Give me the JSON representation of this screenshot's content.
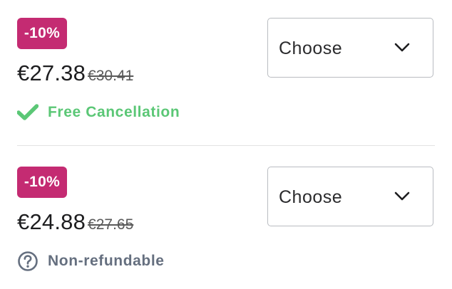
{
  "colors": {
    "badge_background": "#c42b72",
    "free_cancellation": "#5bc776",
    "non_refundable": "#656f7f"
  },
  "offers": [
    {
      "discount": "-10%",
      "price_current": "€27.38",
      "price_old": "€30.41",
      "policy_icon": "checkmark-icon",
      "policy_label": "Free Cancellation",
      "select_value": "Choose",
      "select_icon": "chevron-down-icon"
    },
    {
      "discount": "-10%",
      "price_current": "€24.88",
      "price_old": "€27.65",
      "policy_icon": "question-circle-icon",
      "policy_label": "Non-refundable",
      "select_value": "Choose",
      "select_icon": "chevron-down-icon"
    }
  ]
}
